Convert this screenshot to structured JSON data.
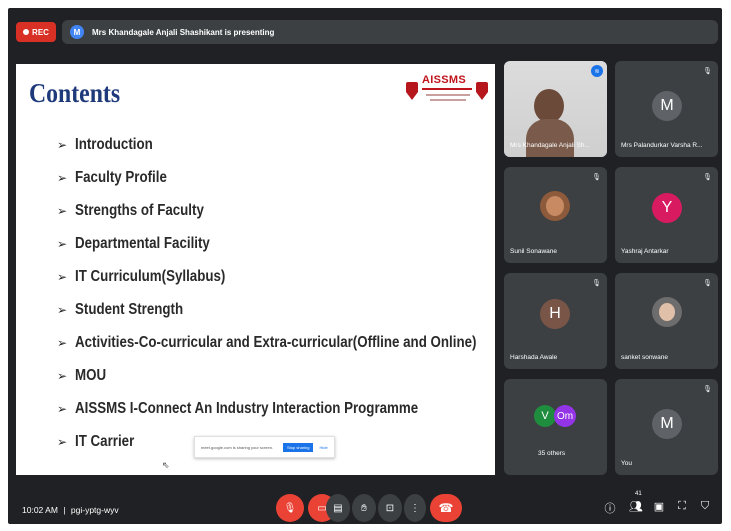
{
  "top_bar": {
    "rec_label": "REC",
    "presenter_initial": "M",
    "presenting_text": "Mrs Khandagale Anjali Shashikant is presenting"
  },
  "slide": {
    "title": "Contents",
    "logo_text": "AISSMS",
    "items": [
      "Introduction",
      "Faculty Profile",
      "Strengths of Faculty",
      "Departmental Facility",
      "IT Curriculum(Syllabus)",
      "Student  Strength",
      "Activities-Co-curricular and Extra-curricular(Offline and Online)",
      "MOU",
      "AISSMS I-Connect An Industry Interaction Programme",
      "IT Carrier"
    ],
    "share_popup": {
      "message": "meet.google.com is sharing your screen.",
      "stop_label": "Stop sharing",
      "hide_label": "Hide"
    }
  },
  "participants": [
    {
      "name": "Mrs Khandagale Anjali Sh...",
      "initial": "",
      "color": "",
      "type": "camera",
      "muted": false
    },
    {
      "name": "Mrs Palandurkar Varsha R...",
      "initial": "M",
      "color": "#5f6368",
      "type": "initial",
      "muted": true
    },
    {
      "name": "Sunil Sonawane",
      "initial": "",
      "color": "#8d5a3b",
      "type": "photo",
      "muted": true
    },
    {
      "name": "Yashraj Antarkar",
      "initial": "Y",
      "color": "#d81b60",
      "type": "initial",
      "muted": true
    },
    {
      "name": "Harshada Awale",
      "initial": "H",
      "color": "#795548",
      "type": "initial",
      "muted": true
    },
    {
      "name": "sanket sonwane",
      "initial": "",
      "color": "#6d6d6d",
      "type": "photo",
      "muted": true
    },
    {
      "name": "35 others",
      "initial": "",
      "color": "",
      "type": "others",
      "muted": false
    },
    {
      "name": "You",
      "initial": "M",
      "color": "#5f6368",
      "type": "initial",
      "muted": true
    }
  ],
  "others_avatars": [
    {
      "initial": "V",
      "color": "#1e8e3e"
    },
    {
      "initial": "Om",
      "color": "#9334e6"
    }
  ],
  "bottom_bar": {
    "time": "10:02 AM",
    "separator": "|",
    "meeting_code": "pgi-yptg-wyv",
    "people_count": "41"
  },
  "icons": {
    "rec": "record-icon",
    "mic": "mic-off-icon",
    "camera": "camera-off-icon",
    "captions": "captions-icon",
    "hand": "raise-hand-icon",
    "present": "present-icon",
    "more": "more-options-icon",
    "end": "end-call-icon",
    "info": "info-icon",
    "people": "people-icon",
    "chat": "chat-icon",
    "activities": "activities-icon",
    "lock": "host-controls-icon"
  }
}
